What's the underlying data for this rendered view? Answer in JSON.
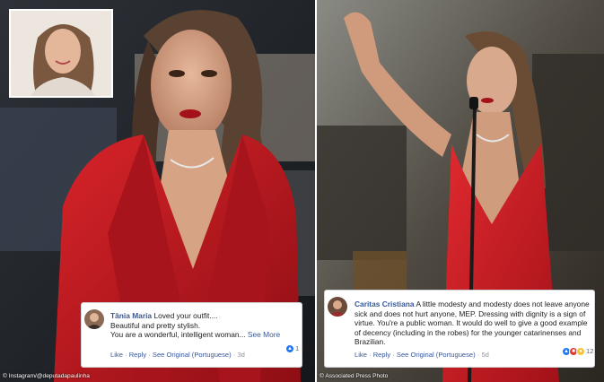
{
  "comments": {
    "left": {
      "author": "Tânia Maria",
      "text_line1": "Loved your outfit....",
      "text_line2": "Beautiful and pretty stylish.",
      "text_line3": "You are a wonderful, intelligent woman...",
      "see_more": "See More",
      "like": "Like",
      "reply": "Reply",
      "see_original": "See Original (Portuguese)",
      "age": "3d",
      "reaction_count": "1"
    },
    "right": {
      "author": "Caritas Cristiana",
      "text": "A little modesty and modesty does not leave anyone sick and does not hurt anyone, MEP. Dressing with dignity is a sign of virtue. You're a public woman. It would do well to give a good example of decency (including in the robes) for the younger catarinenses and Brazilian.",
      "like": "Like",
      "reply": "Reply",
      "see_original": "See Original (Portuguese)",
      "age": "5d",
      "reaction_count": "12"
    }
  },
  "credits": {
    "left": "© Instagram/@deputadapaulinha",
    "right": "© Associated Press Photo"
  },
  "colors": {
    "dress_red": "#c8161d",
    "facebook_link": "#385898"
  }
}
